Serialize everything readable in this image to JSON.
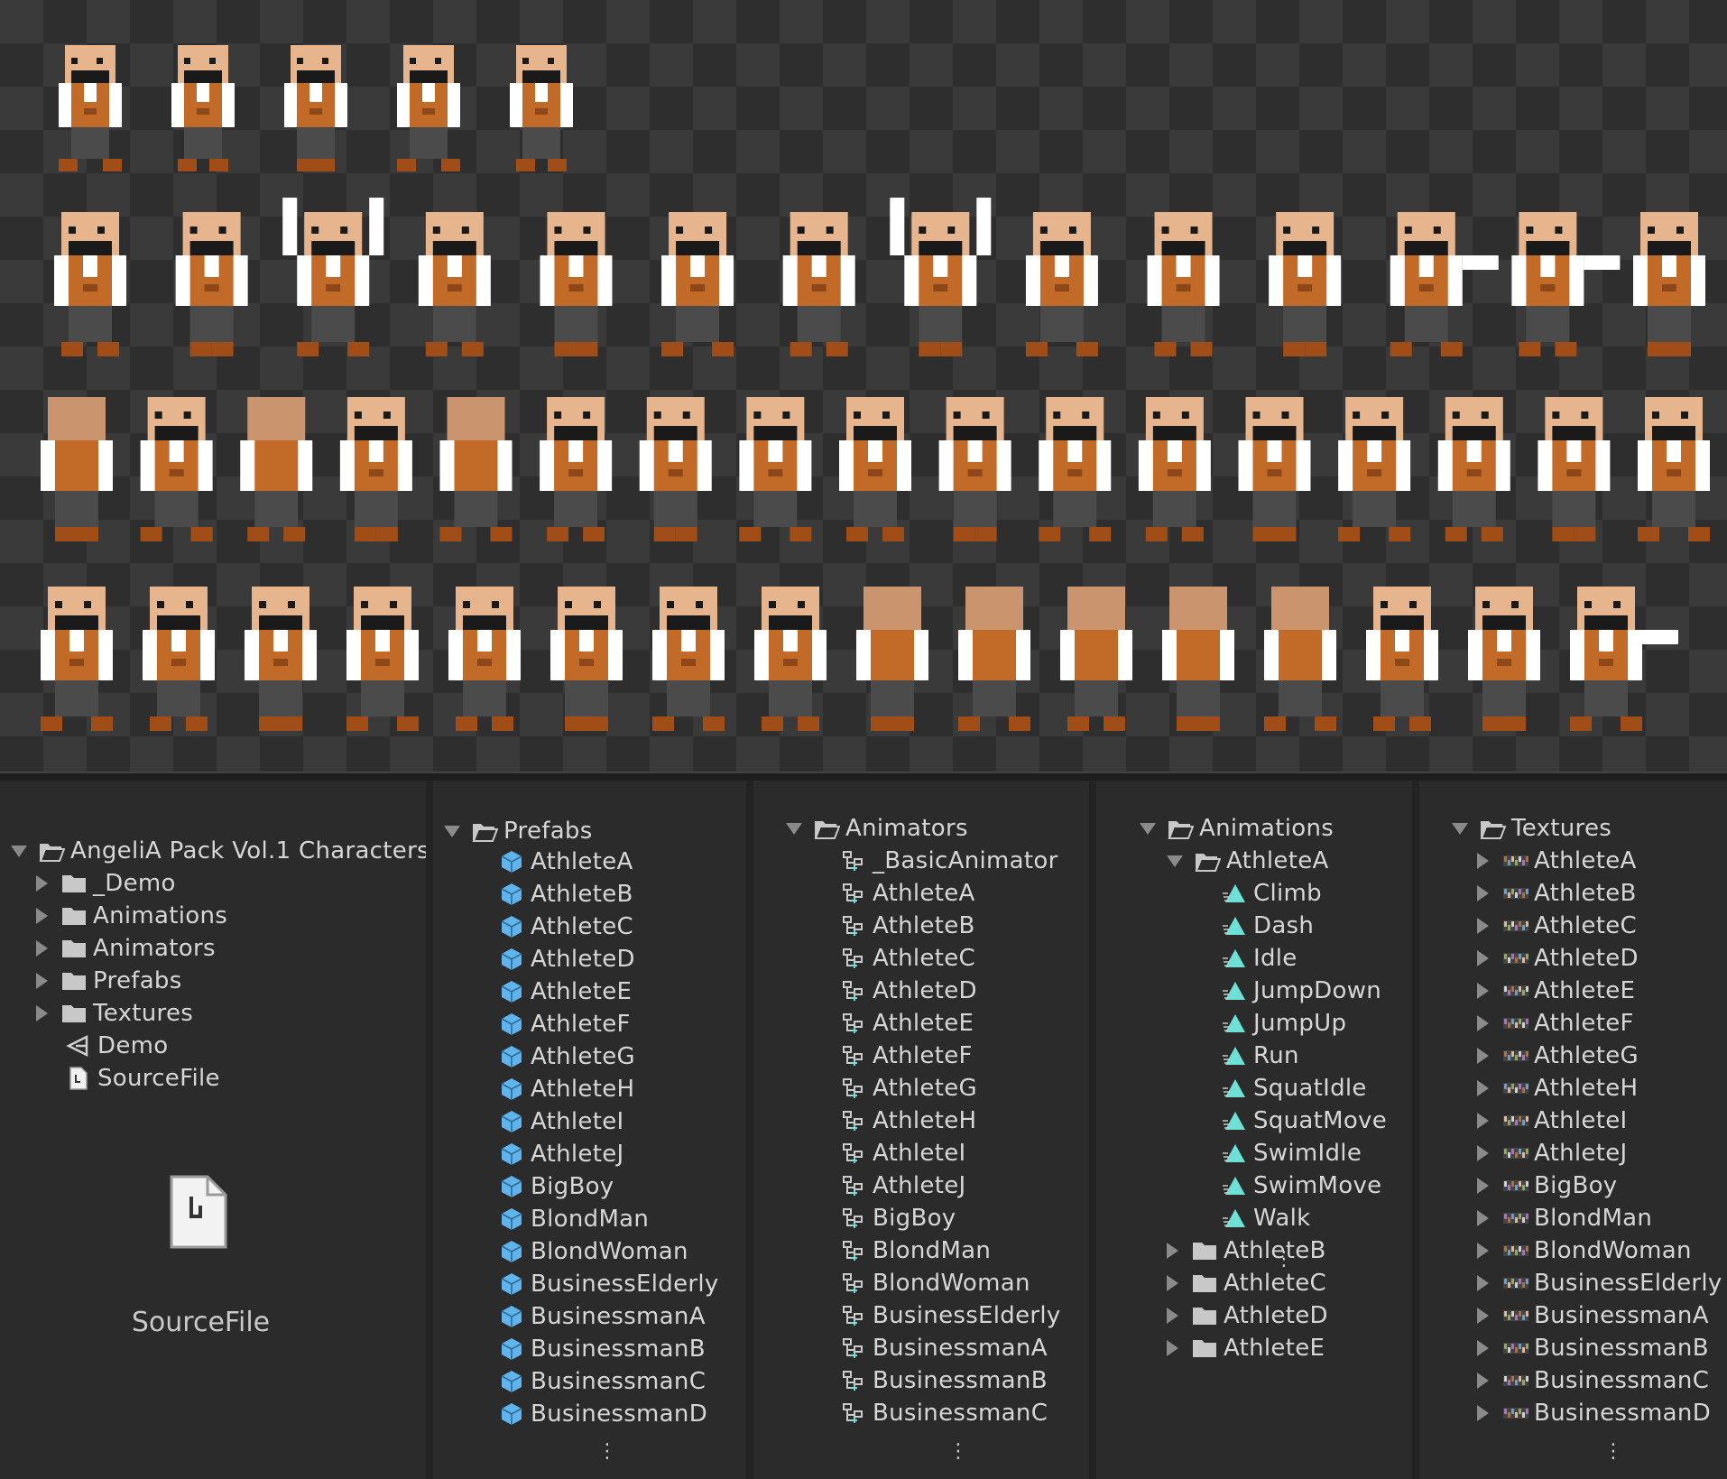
{
  "colors": {
    "skin": "#e6b58e",
    "skin_dark": "#c9946e",
    "vest": "#c26a27",
    "vest_dark": "#8e4718",
    "shirt": "#ffffff",
    "mustache": "#1a1a1a",
    "pants": "#4b4b4b",
    "shoes": "#a04d17",
    "prefab_icon": "#5fb4ec",
    "anim_icon": "#6fe0d6"
  },
  "sprite_sheet": {
    "rows": [
      {
        "count": 5
      },
      {
        "count": 14
      },
      {
        "count": 17
      },
      {
        "count": 16
      }
    ]
  },
  "project_tree": {
    "root": "AngeliA Pack Vol.1 Characters",
    "items": [
      {
        "label": "_Demo",
        "kind": "folder"
      },
      {
        "label": "Animations",
        "kind": "folder"
      },
      {
        "label": "Animators",
        "kind": "folder"
      },
      {
        "label": "Prefabs",
        "kind": "folder"
      },
      {
        "label": "Textures",
        "kind": "folder"
      },
      {
        "label": "Demo",
        "kind": "scene"
      },
      {
        "label": "SourceFile",
        "kind": "file"
      }
    ],
    "preview_label": "SourceFile"
  },
  "prefabs": {
    "title": "Prefabs",
    "items": [
      "AthleteA",
      "AthleteB",
      "AthleteC",
      "AthleteD",
      "AthleteE",
      "AthleteF",
      "AthleteG",
      "AthleteH",
      "AthleteI",
      "AthleteJ",
      "BigBoy",
      "BlondMan",
      "BlondWoman",
      "BusinessElderly",
      "BusinessmanA",
      "BusinessmanB",
      "BusinessmanC",
      "BusinessmanD"
    ],
    "more": "⋮"
  },
  "animators": {
    "title": "Animators",
    "items": [
      "_BasicAnimator",
      "AthleteA",
      "AthleteB",
      "AthleteC",
      "AthleteD",
      "AthleteE",
      "AthleteF",
      "AthleteG",
      "AthleteH",
      "AthleteI",
      "AthleteJ",
      "BigBoy",
      "BlondMan",
      "BlondWoman",
      "BusinessElderly",
      "BusinessmanA",
      "BusinessmanB",
      "BusinessmanC"
    ],
    "more": "⋮"
  },
  "animations": {
    "title": "Animations",
    "expanded_folder": "AthleteA",
    "clips": [
      "Climb",
      "Dash",
      "Idle",
      "JumpDown",
      "JumpUp",
      "Run",
      "SquatIdle",
      "SquatMove",
      "SwimIdle",
      "SwimMove",
      "Walk"
    ],
    "folders": [
      "AthleteB",
      "AthleteC",
      "AthleteD",
      "AthleteE"
    ],
    "more": "⋮"
  },
  "textures": {
    "title": "Textures",
    "items": [
      "AthleteA",
      "AthleteB",
      "AthleteC",
      "AthleteD",
      "AthleteE",
      "AthleteF",
      "AthleteG",
      "AthleteH",
      "AthleteI",
      "AthleteJ",
      "BigBoy",
      "BlondMan",
      "BlondWoman",
      "BusinessElderly",
      "BusinessmanA",
      "BusinessmanB",
      "BusinessmanC",
      "BusinessmanD"
    ],
    "more": "⋮"
  }
}
